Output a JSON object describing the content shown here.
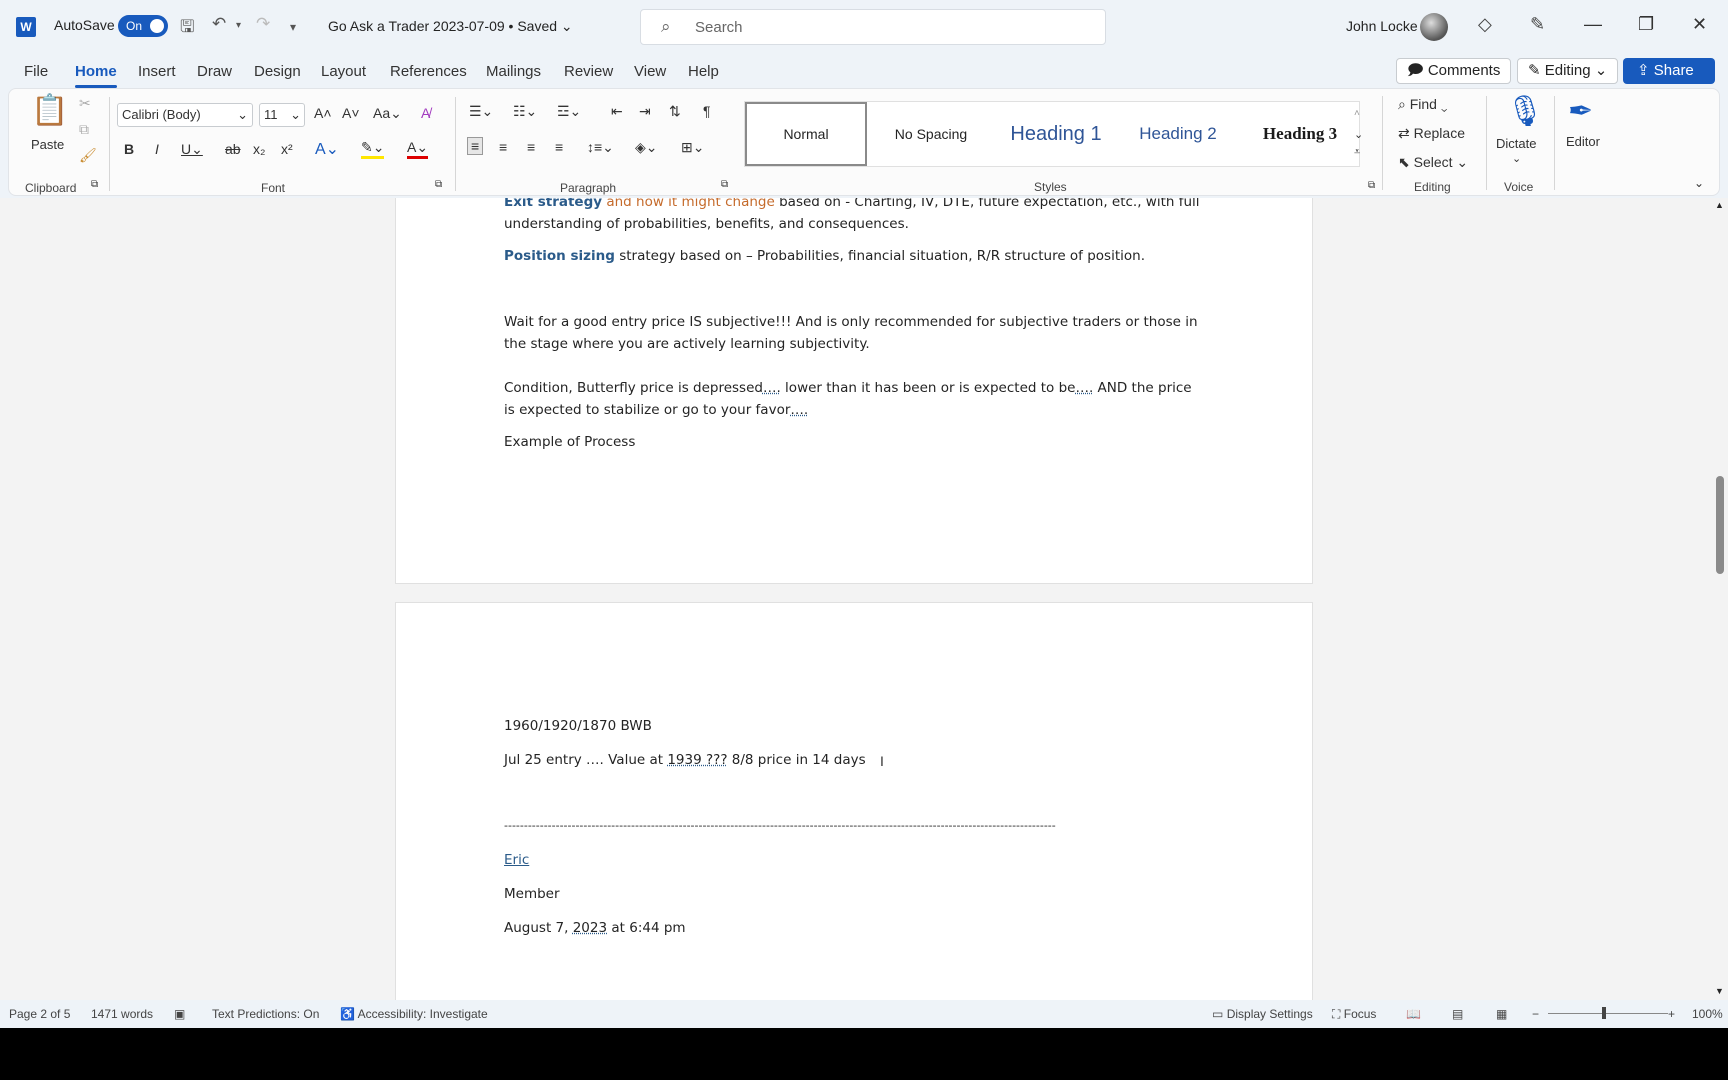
{
  "titlebar": {
    "app_icon": "word-icon",
    "autosave_label": "AutoSave",
    "autosave_state": "On",
    "doc_title": "Go Ask a Trader 2023-07-09 • Saved",
    "search_placeholder": "Search",
    "user_name": "John Locke"
  },
  "menu": [
    "File",
    "Home",
    "Insert",
    "Draw",
    "Design",
    "Layout",
    "References",
    "Mailings",
    "Review",
    "View",
    "Help"
  ],
  "actions": {
    "comments": "Comments",
    "editing": "Editing",
    "share": "Share"
  },
  "ribbon": {
    "clipboard": {
      "paste": "Paste",
      "label": "Clipboard"
    },
    "font": {
      "family": "Calibri (Body)",
      "size": "11",
      "label": "Font"
    },
    "paragraph": {
      "label": "Paragraph"
    },
    "styles": {
      "items": [
        "Normal",
        "No Spacing",
        "Heading 1",
        "Heading 2",
        "Heading 3"
      ],
      "label": "Styles"
    },
    "editing": {
      "find": "Find",
      "replace": "Replace",
      "select": "Select",
      "label": "Editing"
    },
    "voice": {
      "dictate": "Dictate",
      "label": "Voice"
    },
    "editor": "Editor"
  },
  "document": {
    "page1": {
      "exit_strategy_bold": "Exit strategy",
      "exit_strategy_orange": " and how it might change",
      "exit_strategy_rest": " based on - Charting, IV, DTE, future expectation, etc., with full understanding of probabilities, benefits, and consequences.",
      "position_sizing_bold": "Position sizing",
      "position_sizing_rest": " strategy based on – Probabilities, financial situation, R/R structure of position.",
      "wait": "Wait for a good entry price IS subjective!!! And is only recommended for subjective traders or those in the stage where you are actively learning subjectivity.",
      "condition_a": " Condition, Butterfly price is depressed",
      "condition_dots1": "….",
      "condition_b": " lower than it has been or is expected to be",
      "condition_dots2": "….",
      "condition_c": " AND the price is expected to stabilize or go to your favor",
      "condition_dots3": "….",
      "example": "Example of Process"
    },
    "page2": {
      "bwb": "1960/1920/1870 BWB",
      "entry_a": "Jul 25 entry …. Value at ",
      "entry_underlined": "1939 ???",
      "entry_b": " 8/8 price in 14 days",
      "divider": "-------------------------------------------------------------------------------------------------------------------------------------------",
      "author": "Eric",
      "role": "Member",
      "date_a": " August 7, ",
      "date_year": "2023",
      "date_b": " at 6:44 pm"
    }
  },
  "status": {
    "page": "Page 2 of 5",
    "words": "1471 words",
    "text_predictions": "Text Predictions: On",
    "accessibility": "Accessibility: Investigate",
    "display_settings": "Display Settings",
    "focus": "Focus",
    "zoom": "100%"
  }
}
